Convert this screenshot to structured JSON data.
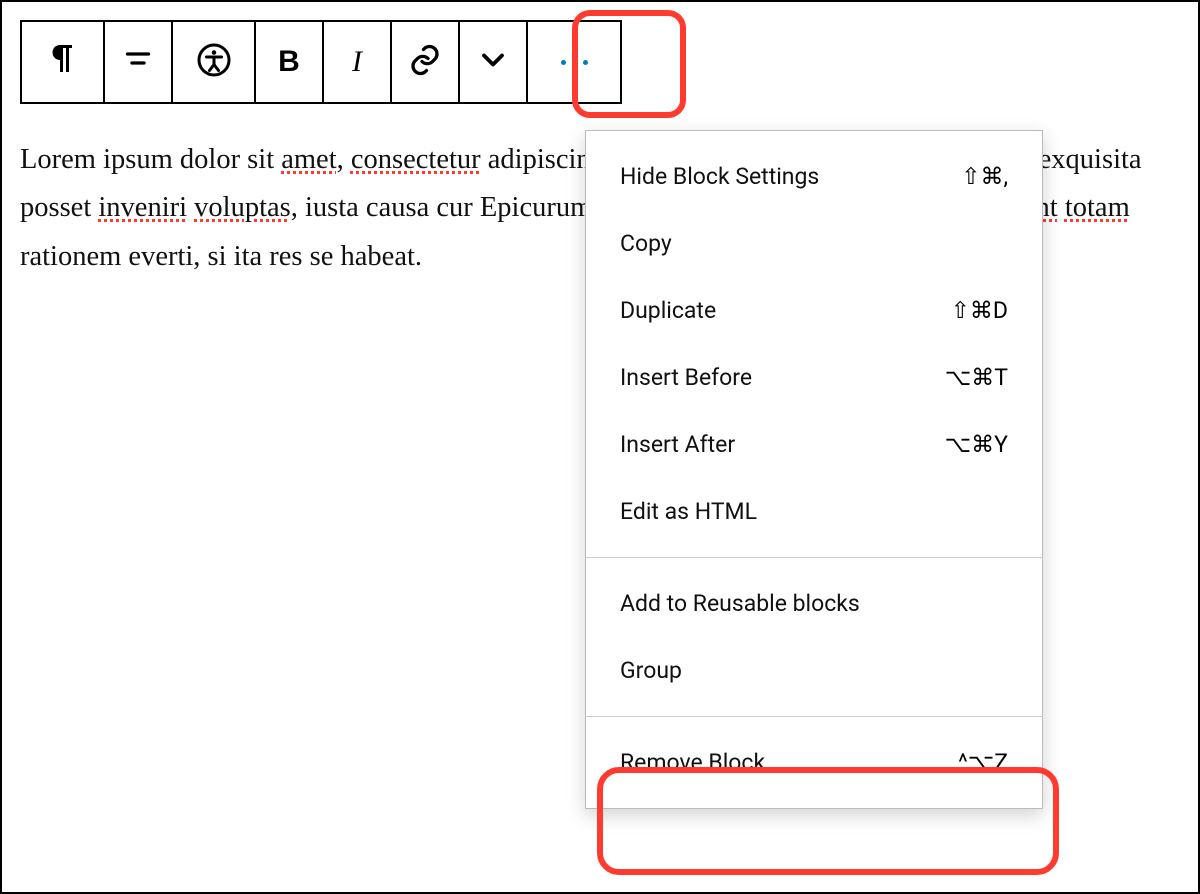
{
  "paragraph": {
    "text_parts": [
      {
        "t": "Lorem ipsum dolor sit ",
        "err": false
      },
      {
        "t": "amet",
        "err": true
      },
      {
        "t": ", ",
        "err": false
      },
      {
        "t": "consectetur",
        "err": true
      },
      {
        "t": " adipiscing elit. Nec enim, dum metuit nulla tam exquisita posset ",
        "err": false
      },
      {
        "t": "inveniri",
        "err": true
      },
      {
        "t": " ",
        "err": false
      },
      {
        "t": "voluptas",
        "err": true
      },
      {
        "t": ", iusta causa cur Epicurum. Quorum sine doctissimi non ",
        "err": false
      },
      {
        "t": "intellegunt",
        "err": true
      },
      {
        "t": " ",
        "err": false
      },
      {
        "t": "totam",
        "err": true
      },
      {
        "t": " rationem everti, si ita res se habeat.",
        "err": false
      }
    ]
  },
  "toolbar": {
    "items": [
      {
        "name": "paragraph-icon"
      },
      {
        "name": "align-icon"
      },
      {
        "name": "accessibility-icon"
      },
      {
        "name": "bold-icon"
      },
      {
        "name": "italic-icon"
      },
      {
        "name": "link-icon"
      },
      {
        "name": "chevron-down-icon"
      },
      {
        "name": "more-options-icon"
      }
    ]
  },
  "menu": {
    "group1": [
      {
        "label": "Hide Block Settings",
        "shortcut": "⇧⌘,"
      },
      {
        "label": "Copy",
        "shortcut": ""
      },
      {
        "label": "Duplicate",
        "shortcut": "⇧⌘D"
      },
      {
        "label": "Insert Before",
        "shortcut": "⌥⌘T"
      },
      {
        "label": "Insert After",
        "shortcut": "⌥⌘Y"
      },
      {
        "label": "Edit as HTML",
        "shortcut": ""
      }
    ],
    "group2": [
      {
        "label": "Add to Reusable blocks",
        "shortcut": ""
      },
      {
        "label": "Group",
        "shortcut": ""
      }
    ],
    "group3": [
      {
        "label": "Remove Block",
        "shortcut": "^⌥Z"
      }
    ]
  }
}
